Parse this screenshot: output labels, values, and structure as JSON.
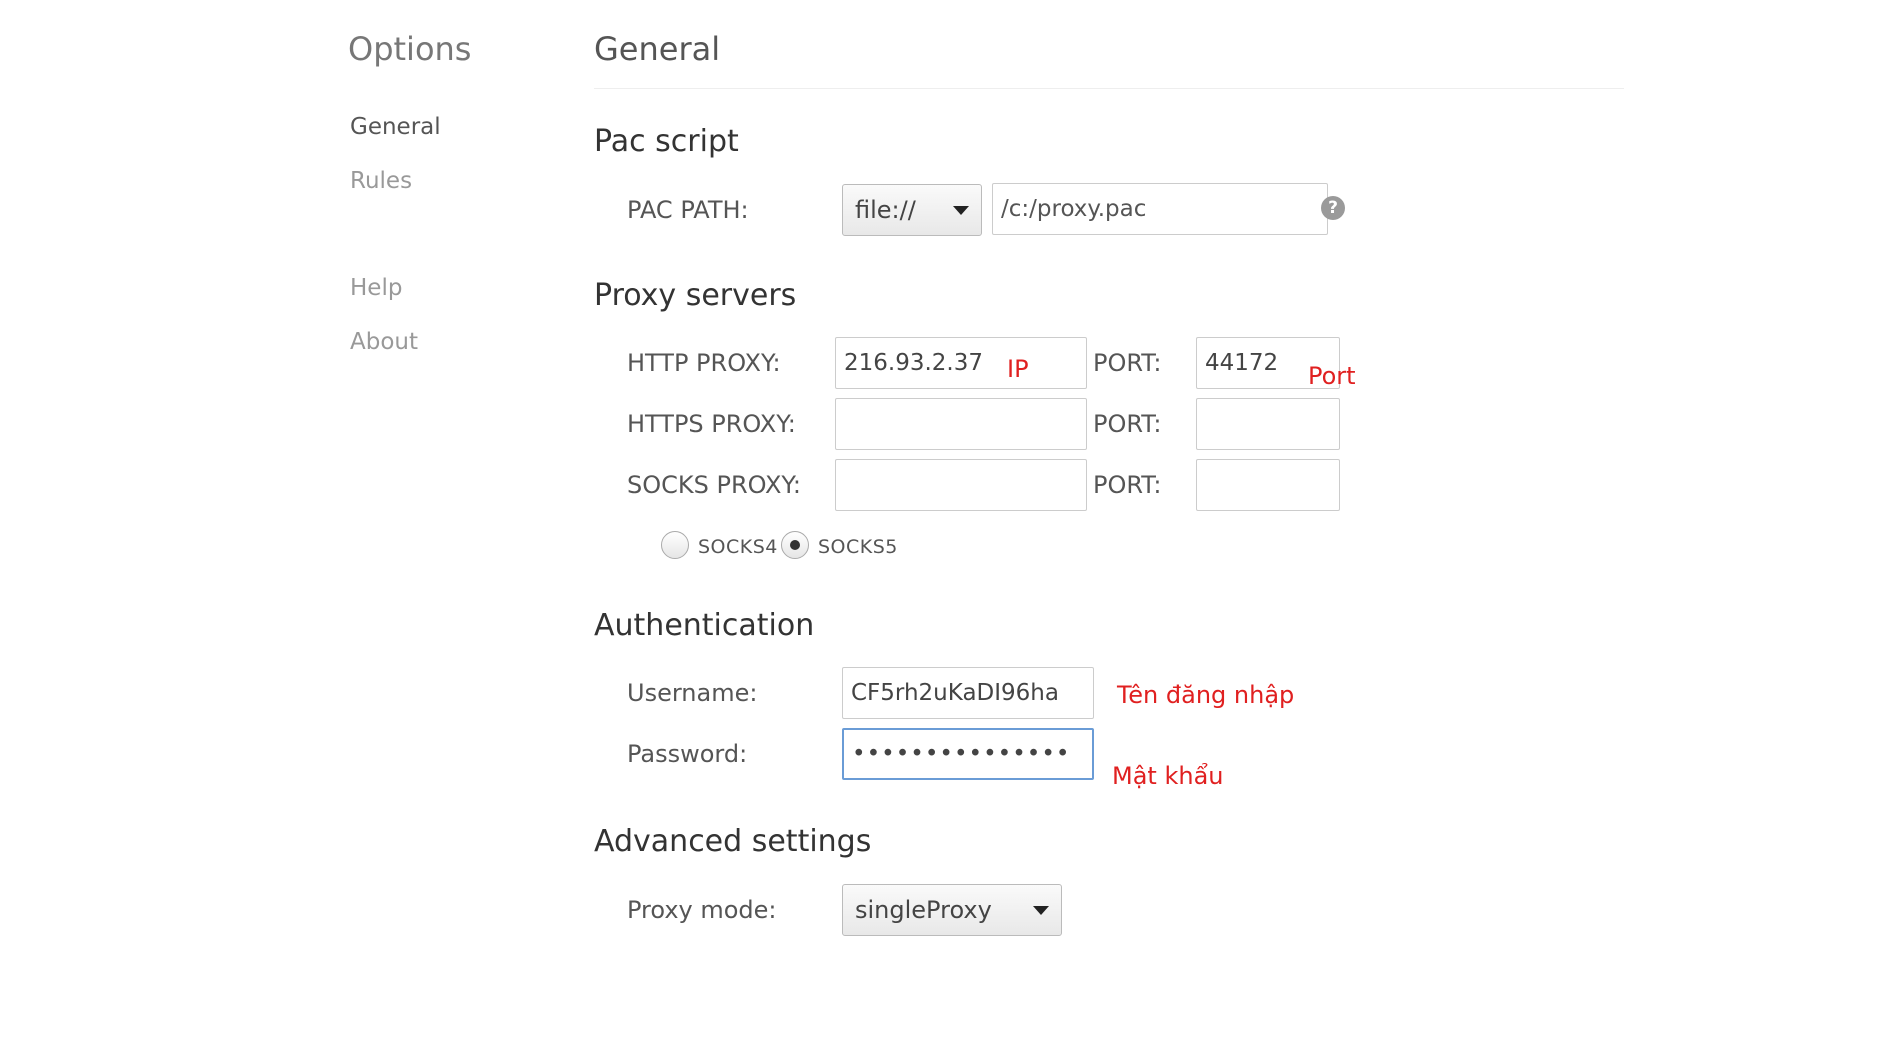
{
  "sidebar": {
    "title": "Options",
    "items": [
      {
        "label": "General",
        "active": true
      },
      {
        "label": "Rules",
        "active": false
      },
      {
        "label": "Help",
        "active": false
      },
      {
        "label": "About",
        "active": false
      }
    ]
  },
  "main": {
    "title": "General",
    "pac_script": {
      "heading": "Pac script",
      "label": "PAC PATH:",
      "protocol": "file://",
      "placeholder": "/c:/proxy.pac"
    },
    "proxy_servers": {
      "heading": "Proxy servers",
      "http": {
        "label": "HTTP PROXY:",
        "value": "216.93.2.37",
        "port_label": "PORT:",
        "port": "44172"
      },
      "https": {
        "label": "HTTPS PROXY:",
        "value": "",
        "port_label": "PORT:",
        "port": ""
      },
      "socks": {
        "label": "SOCKS PROXY:",
        "value": "",
        "port_label": "PORT:",
        "port": ""
      },
      "socks_versions": [
        {
          "label": "SOCKS4",
          "checked": false
        },
        {
          "label": "SOCKS5",
          "checked": true
        }
      ]
    },
    "authentication": {
      "heading": "Authentication",
      "username_label": "Username:",
      "username": "CF5rh2uKaDI96ha",
      "password_label": "Password:",
      "password_masked": "•••••••••••••••"
    },
    "advanced": {
      "heading": "Advanced settings",
      "mode_label": "Proxy mode:",
      "mode": "singleProxy"
    }
  },
  "annotations": {
    "ip": "IP",
    "port": "Port",
    "username": "Tên đăng nhập",
    "password": "Mật khẩu"
  },
  "colors": {
    "annotation": "#e02020",
    "focus_border": "#6a9cd6"
  }
}
